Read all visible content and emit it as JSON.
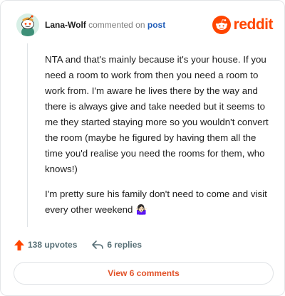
{
  "comment": {
    "username": "Lana-Wolf",
    "action_text": "commented on",
    "post_link": "post",
    "paragraphs": [
      "NTA and that's mainly because it's your house. If you need a room to work from then you need a room to work from. I'm aware he lives there by the way and there is always give and take needed but it seems to me they started staying more so you wouldn't convert the room (maybe he figured by having them all the time you'd realise you need the rooms for them, who knows!)",
      "I'm pretty sure his family don't need to come and visit every other weekend 🤷🏻‍♀️"
    ]
  },
  "brand": {
    "wordmark": "reddit",
    "color": "#ff4500"
  },
  "stats": {
    "upvotes": "138 upvotes",
    "replies": "6 replies"
  },
  "footer": {
    "view_comments": "View 6 comments"
  },
  "icons": {
    "avatar": "snoo-avatar-icon",
    "logo": "reddit-logo-icon",
    "upvote": "upvote-arrow-icon",
    "reply": "reply-arrow-icon"
  }
}
